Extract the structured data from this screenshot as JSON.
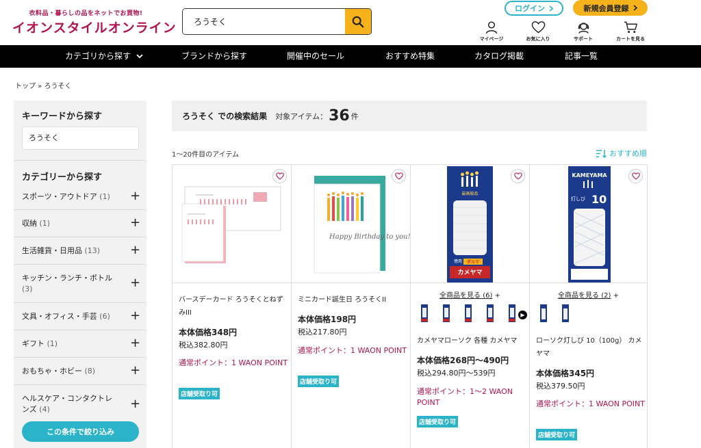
{
  "header": {
    "logo_tagline": "衣料品・暮らしの品をネットでお買物!",
    "logo_name": "イオンスタイルオンライン",
    "search_value": "ろうそく",
    "login_label": "ログイン",
    "register_label": "新規会員登録",
    "icons": [
      {
        "name": "user-icon",
        "label": "マイページ"
      },
      {
        "name": "heart-icon",
        "label": "お気に入り"
      },
      {
        "name": "support-icon",
        "label": "サポート"
      },
      {
        "name": "cart-icon",
        "label": "カートを見る"
      }
    ]
  },
  "nav": {
    "items": [
      "カテゴリから探す",
      "ブランドから探す",
      "開催中のセール",
      "おすすめ特集",
      "カタログ掲載",
      "記事一覧"
    ]
  },
  "breadcrumb": {
    "text": "トップ » ろうそく"
  },
  "sidebar": {
    "keyword_title": "キーワードから探す",
    "keyword_value": "ろうそく",
    "category_title": "カテゴリーから探す",
    "categories": [
      {
        "label": "スポーツ・アウトドア",
        "count": "(1)"
      },
      {
        "label": "収納",
        "count": "(1)"
      },
      {
        "label": "生活雑貨・日用品",
        "count": "(13)"
      },
      {
        "label": "キッチン・ランチ・ボトル",
        "count": "(3)"
      },
      {
        "label": "文具・オフィス・手芸",
        "count": "(6)"
      },
      {
        "label": "ギフト",
        "count": "(1)"
      },
      {
        "label": "おもちゃ・ホビー",
        "count": "(8)"
      },
      {
        "label": "ヘルスケア・コンタクトレンズ",
        "count": "(4)"
      }
    ],
    "apply_label": "この条件で絞り込み"
  },
  "results": {
    "query": "ろうそく での検索結果",
    "target_label": "対象アイテム：",
    "count": "36",
    "unit": "件",
    "range": "1〜20件目のアイテム",
    "sort_label": "おすすめ順"
  },
  "products": [
    {
      "name": "バースデーカード ろうそくとねずみIII",
      "price": "本体価格348円",
      "tax": "税込382.80円",
      "point": "通常ポイント：1 WAON POINT",
      "badge": "店舗受取り可"
    },
    {
      "name": "ミニカード誕生日 ろうそくII",
      "price": "本体価格198円",
      "tax": "税込217.80円",
      "point": "通常ポイント：1 WAON POINT",
      "badge": "店舗受取り可",
      "card_text": "Happy Birthday to you!"
    },
    {
      "variants_link": "全商品を見る (6)",
      "name": "カメヤマローソク 各種 カメヤマ",
      "price": "本体価格268円〜490円",
      "tax": "税込294.80円〜539円",
      "point": "通常ポイント：1〜2 WAON POINT",
      "badge": "店舗受取り可",
      "box_text_top": "最高級品",
      "box_text_mid": "徳用",
      "box_text_brand": "ダルマ",
      "box_text_maker": "カメヤマ"
    },
    {
      "variants_link": "全商品を見る (2)",
      "name": "ローソク灯しび 10（100g） カメヤマ",
      "price": "本体価格345円",
      "tax": "税込379.50円",
      "point": "通常ポイント：1 WAON POINT",
      "badge": "店舗受取り可",
      "box_text_top": "KAMEYAMA",
      "box_text_mid": "灯しび",
      "box_text_num": "10"
    }
  ]
}
